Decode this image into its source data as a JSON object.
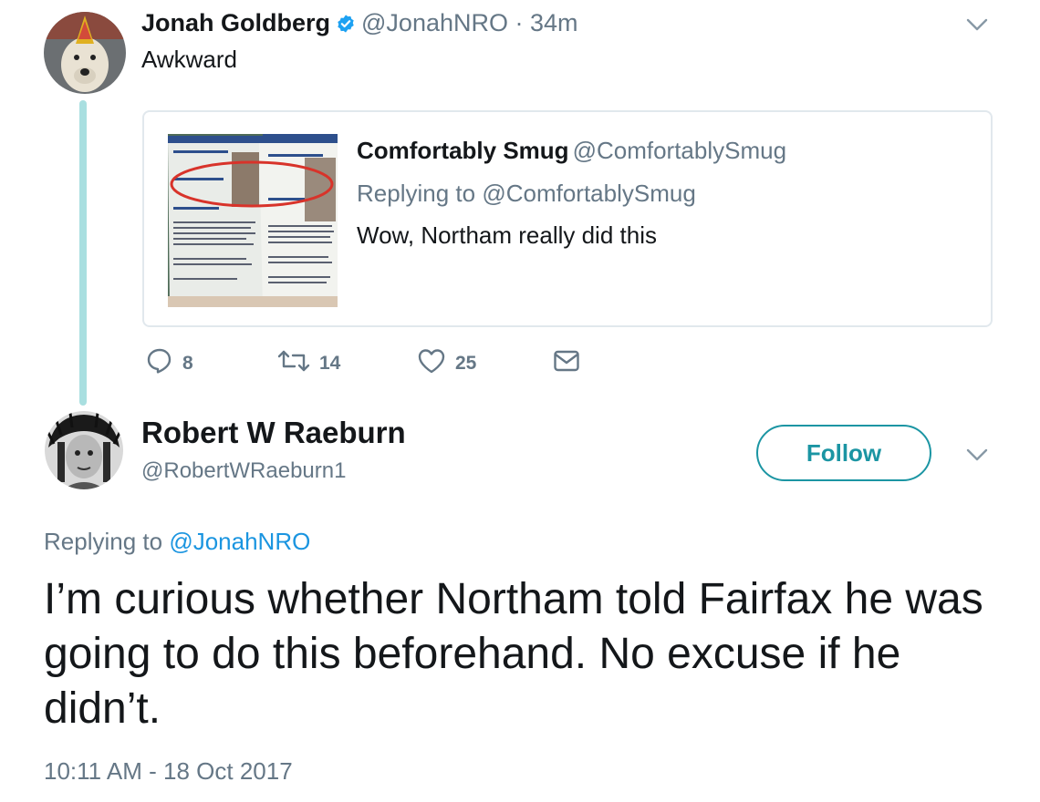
{
  "tweet": {
    "name": "Jonah Goldberg",
    "handle": "@JonahNRO",
    "time": " · 34m",
    "text": "Awkward",
    "quoted": {
      "name": "Comfortably Smug",
      "handle": "@ComfortablySmug",
      "replying_prefix": "Replying to ",
      "replying_handle": "@ComfortablySmug",
      "text": "Wow, Northam really did this"
    },
    "actions": {
      "replies": "8",
      "retweets": "14",
      "likes": "25"
    }
  },
  "reply": {
    "name": "Robert W Raeburn",
    "handle": "@RobertWRaeburn1",
    "follow_label": "Follow",
    "replying_prefix": "Replying to ",
    "replying_handle": "@JonahNRO",
    "text": "I’m curious whether Northam told Fairfax he was going to do this beforehand. No excuse if he didn’t.",
    "timestamp": "10:11 AM - 18 Oct 2017"
  },
  "colors": {
    "accent": "#1b95e0",
    "follow": "#1b95a3",
    "thread_line": "#a9dfe0",
    "muted": "#657786"
  },
  "icons": [
    "reply-icon",
    "retweet-icon",
    "like-icon",
    "message-icon",
    "verified-icon",
    "chevron-down-icon"
  ]
}
